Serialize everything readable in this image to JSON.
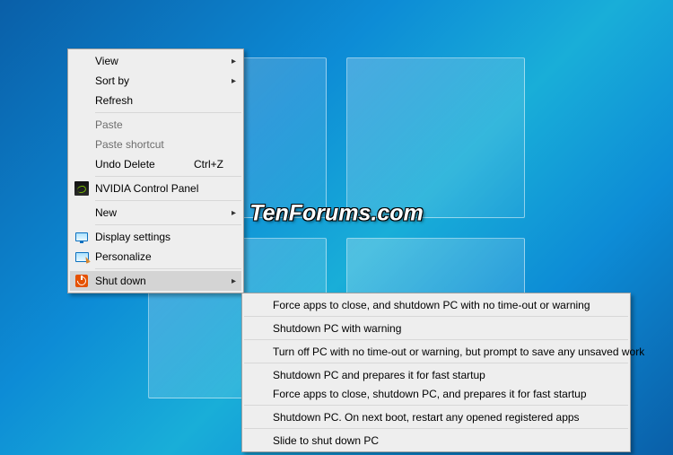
{
  "watermark": "TenForums.com",
  "menu": {
    "view": "View",
    "sortBy": "Sort by",
    "refresh": "Refresh",
    "paste": "Paste",
    "pasteShortcut": "Paste shortcut",
    "undoDelete": "Undo Delete",
    "undoDeleteShortcut": "Ctrl+Z",
    "nvidia": "NVIDIA Control Panel",
    "new": "New",
    "displaySettings": "Display settings",
    "personalize": "Personalize",
    "shutdown": "Shut down"
  },
  "submenu": {
    "forceClose": "Force apps to close, and shutdown PC with no time-out or warning",
    "withWarning": "Shutdown PC with warning",
    "turnOff": "Turn off PC with no time-out or warning, but prompt to save any unsaved work",
    "fastStartup": "Shutdown PC and prepares it for fast startup",
    "forceCloseFast": "Force apps to close, shutdown PC, and prepares it for fast startup",
    "nextBoot": "Shutdown PC. On next boot, restart any opened registered apps",
    "slide": "Slide to shut down PC"
  }
}
